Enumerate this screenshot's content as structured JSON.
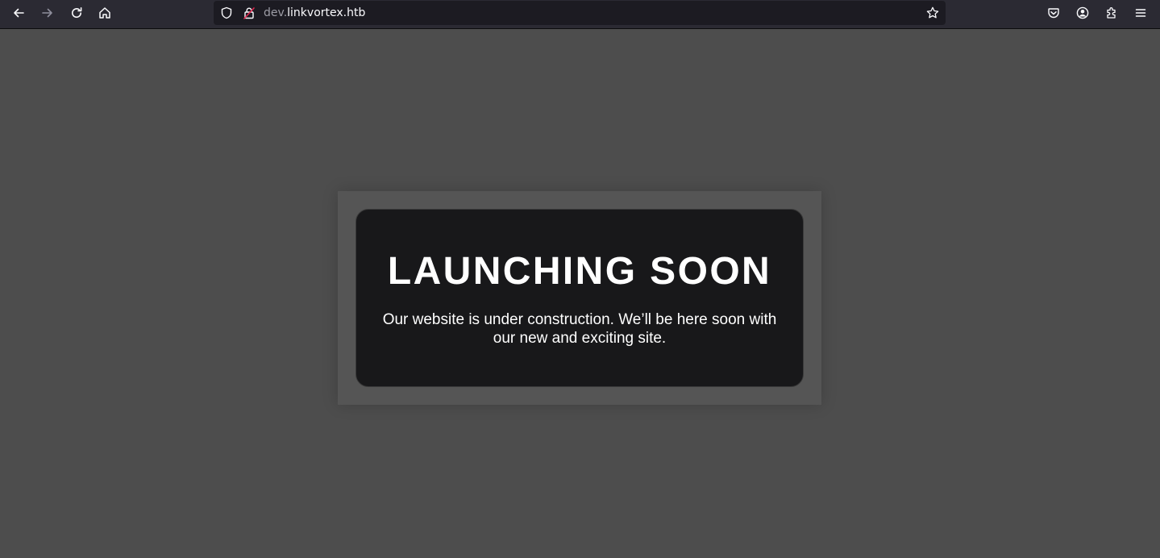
{
  "browser": {
    "url_subdomain": "dev.",
    "url_domain": "linkvortex.htb",
    "icons": {
      "back": "back-arrow-icon",
      "forward": "forward-arrow-icon",
      "reload": "reload-icon",
      "home": "home-icon",
      "tracking_protection": "shield-icon",
      "connection": "insecure-lock-icon",
      "bookmark": "star-icon",
      "pocket": "pocket-icon",
      "account": "account-icon",
      "extensions": "puzzle-icon",
      "menu": "hamburger-menu-icon"
    },
    "colors": {
      "toolbar": "#2b2a33",
      "urlbar": "#1c1b22",
      "icon": "#fbfbfe",
      "icon_disabled": "#8f8f9d",
      "insecure_accent": "#e22850"
    }
  },
  "page": {
    "headline": "LAUNCHING SOON",
    "message": "Our website is under construction. We’ll be here soon with our new and exciting site.",
    "colors": {
      "background": "#4d4d4d",
      "outer_card": "#555555",
      "inner_card": "#18181a",
      "text": "#ffffff"
    }
  }
}
